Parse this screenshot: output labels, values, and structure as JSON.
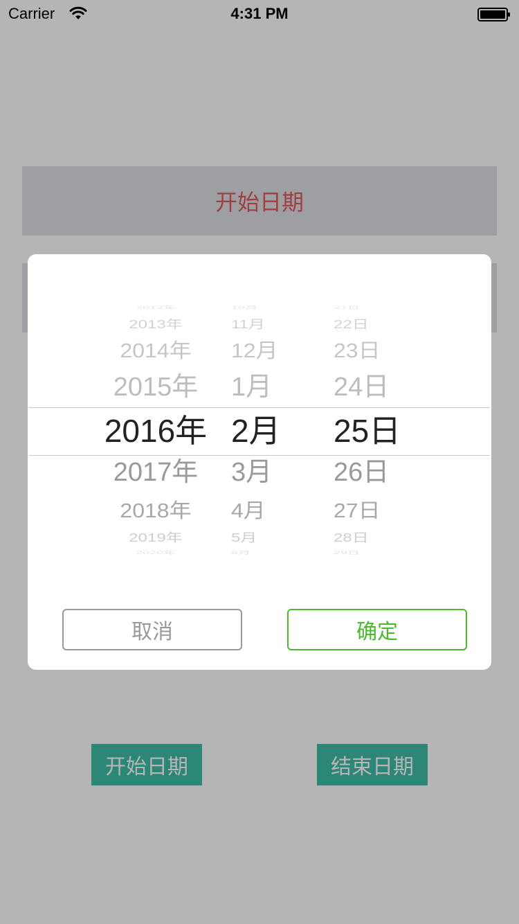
{
  "status_bar": {
    "carrier": "Carrier",
    "time": "4:31 PM",
    "icons": [
      "wifi-icon",
      "battery-icon"
    ]
  },
  "page": {
    "start_date_field": "开始日期",
    "end_date_field": "",
    "start_date_button": "开始日期",
    "end_date_button": "结束日期"
  },
  "picker": {
    "years": [
      "2012年",
      "2013年",
      "2014年",
      "2015年",
      "2016年",
      "2017年",
      "2018年",
      "2019年",
      "2020年"
    ],
    "months": [
      "10月",
      "11月",
      "12月",
      "1月",
      "2月",
      "3月",
      "4月",
      "5月",
      "6月"
    ],
    "days": [
      "21日",
      "22日",
      "23日",
      "24日",
      "25日",
      "26日",
      "27日",
      "28日",
      "29日"
    ],
    "selected": {
      "year": "2016年",
      "month": "2月",
      "day": "25日"
    }
  },
  "dialog": {
    "cancel_label": "取消",
    "confirm_label": "确定"
  },
  "colors": {
    "confirm_accent": "#4cb82e",
    "cancel_gray": "#9a9a9a",
    "teal_button": "#3fbfa8",
    "field_text": "#e05a5a",
    "overlay": "rgba(0,0,0,0.29)"
  }
}
